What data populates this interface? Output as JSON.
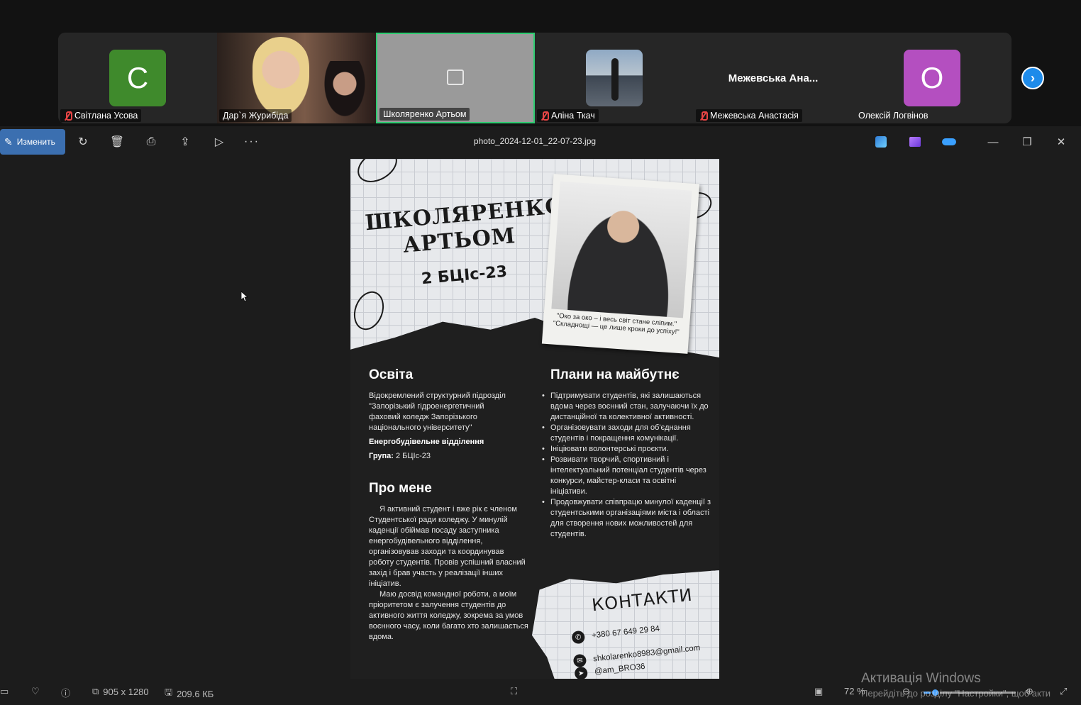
{
  "meeting": {
    "participants": [
      {
        "name": "Світлана Усова",
        "muted": true,
        "avatar_letter": "С",
        "avatar_color": "#3f8a2c"
      },
      {
        "name": "Дар`я Журибіда",
        "muted": false
      },
      {
        "name": "Школяренко Артьом",
        "muted": false,
        "active_speaker": true
      },
      {
        "name": "Аліна Ткач",
        "muted": true
      },
      {
        "name": "Межевська Анастасія",
        "muted": true,
        "display_text": "Межевська  Ана..."
      },
      {
        "name": "Олексій Логвінов",
        "muted": false,
        "avatar_letter": "О",
        "avatar_color": "#b44fc0"
      }
    ],
    "next_icon": "chevron-right-icon"
  },
  "viewer": {
    "edit_label": "Изменить",
    "filename": "photo_2024-12-01_22-07-23.jpg",
    "toolbar_icons": [
      "rotate-icon",
      "delete-icon",
      "print-icon",
      "share-icon",
      "slideshow-icon",
      "more-icon"
    ],
    "apps_icons": [
      "designer-icon",
      "clipchamp-icon",
      "onedrive-icon"
    ]
  },
  "poster": {
    "name": "ШКОЛЯРЕНКО АРТЬОМ",
    "group": "2 БЦІс-23",
    "quote": "\"Око за око – і весь світ стане сліпим.\" \"Складнощі — це лише кроки до успіху!\"",
    "education": {
      "heading": "Освіта",
      "institution": "Відокремлений структурний підрозділ \"Запорізький гідроенергетичний фаховий коледж Запорізького національного університету\"",
      "department": "Енергобудівельне відділення",
      "group_label": "Група:",
      "group_value": "2 БЦІс-23"
    },
    "about": {
      "heading": "Про мене",
      "p1": "Я активний студент і вже рік є членом Студентської ради коледжу. У минулій каденції обіймав посаду заступника енергобудівельного відділення, організовував заходи та координував роботу студентів. Провів успішний власний захід і брав участь у реалізації інших ініціатив.",
      "p2": "Маю досвід командної роботи, а моїм пріоритетом є залучення студентів до активного життя коледжу, зокрема за умов воєнного часу, коли багато хто залишається вдома."
    },
    "plans": {
      "heading": "Плани на майбутнє",
      "items": [
        "Підтримувати студентів, які залишаються вдома через воєнний стан, залучаючи їх до дистанційної та колективної активності.",
        "Організовувати заходи для об'єднання студентів і покращення комунікації.",
        "Ініціювати волонтерські проєкти.",
        "Розвивати творчий, спортивний і інтелектуальний потенціал студентів через конкурси, майстер-класи та освітні ініціативи.",
        "Продовжувати співпрацю минулої каденції з студентськими організаціями міста і області для створення нових можливостей для студентів."
      ]
    },
    "contacts": {
      "heading": "КОНТАКТИ",
      "phone": "+380 67 649 29 84",
      "email": "shkolarenko8983@gmail.com",
      "telegram": "@am_BRO36"
    }
  },
  "status": {
    "dimensions": "905 x 1280",
    "filesize": "209.6 КБ",
    "zoom": "72 %",
    "zoom_fraction": 0.12
  },
  "watermark": {
    "title": "Активація Windows",
    "subtitle": "Перейдіть до розділу \"Настройки\", щоб акти"
  },
  "colors": {
    "accent": "#3b6fb0",
    "active_tile_border": "#2ecc71",
    "zoom_accent": "#4aa3ff"
  }
}
